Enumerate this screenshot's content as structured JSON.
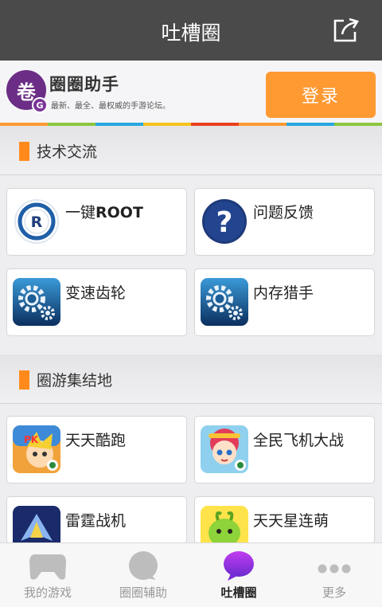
{
  "header": {
    "title": "吐槽圈"
  },
  "banner": {
    "logo_char": "卷",
    "logo_badge": "G",
    "brand_name": "圈圈助手",
    "tagline": "最新、最全、最权威的手游论坛。",
    "login_label": "登录"
  },
  "colors": {
    "accent": "#ff9932",
    "section_bar": "#ff8a1c",
    "rainbow": [
      "#ff9932",
      "#8cc63f",
      "#27a7e0",
      "#f7c21b",
      "#e8401c",
      "#ff9932",
      "#27a7e0",
      "#8cc63f"
    ]
  },
  "sections": [
    {
      "label": "技术交流",
      "items": [
        {
          "label": "一键ROOT",
          "icon": "root-icon"
        },
        {
          "label": "问题反馈",
          "icon": "question-icon"
        },
        {
          "label": "变速齿轮",
          "icon": "gear-icon"
        },
        {
          "label": "内存猎手",
          "icon": "gear-icon"
        }
      ]
    },
    {
      "label": "圈游集结地",
      "items": [
        {
          "label": "天天酷跑",
          "icon": "game-cover-icon"
        },
        {
          "label": "全民飞机大战",
          "icon": "game-cover-icon"
        },
        {
          "label": "雷霆战机",
          "icon": "game-cover-icon"
        },
        {
          "label": "天天星连萌",
          "icon": "game-cover-icon"
        }
      ]
    }
  ],
  "tabs": [
    {
      "label": "我的游戏",
      "icon": "gamepad-icon"
    },
    {
      "label": "圈圈辅助",
      "icon": "circle-helper-icon"
    },
    {
      "label": "吐槽圈",
      "icon": "chat-bubble-icon",
      "active": true
    },
    {
      "label": "更多",
      "icon": "more-dots-icon"
    }
  ]
}
